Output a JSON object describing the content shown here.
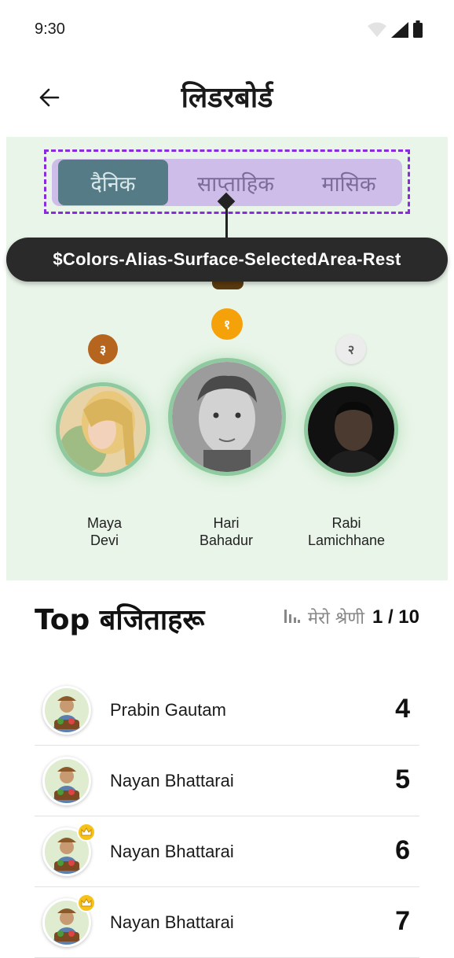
{
  "status_bar": {
    "time": "9:30",
    "icons": [
      "wifi-icon",
      "signal-icon",
      "battery-icon"
    ]
  },
  "header": {
    "back_icon": "arrow-left-icon",
    "title": "लिडरबोर्ड"
  },
  "tabs": [
    {
      "label": "दैनिक",
      "active": true
    },
    {
      "label": "साप्ताहिक",
      "active": false
    },
    {
      "label": "मासिक",
      "active": false
    }
  ],
  "design_token": "$Colors-Alias-Surface-SelectedArea-Rest",
  "podium": [
    {
      "rank": "३",
      "name_line1": "Maya",
      "name_line2": "Devi",
      "badge_color": "#b5651d"
    },
    {
      "rank": "१",
      "name_line1": "Hari",
      "name_line2": "Bahadur",
      "badge_color": "#f5a20a"
    },
    {
      "rank": "२",
      "name_line1": "Rabi",
      "name_line2": "Lamichhane",
      "badge_color": "#e6e6e6"
    }
  ],
  "winners": {
    "title": "Top बजिताहरू",
    "my_rank_icon": "bar-chart-icon",
    "my_rank_label": "मेरो श्रेणी",
    "my_rank_value": "1 / 10"
  },
  "list": [
    {
      "name": "Prabin Gautam",
      "score": "4",
      "crown": false
    },
    {
      "name": "Nayan Bhattarai",
      "score": "5",
      "crown": false
    },
    {
      "name": "Nayan Bhattarai",
      "score": "6",
      "crown": true
    },
    {
      "name": "Nayan Bhattarai",
      "score": "7",
      "crown": true
    }
  ],
  "colors": {
    "podium_bg": "#eaf5ea",
    "tab_bg": "#cdbde8",
    "tab_active": "#557c86",
    "selection_outline": "#8a2be2",
    "avatar_ring": "#8fc9a0"
  }
}
